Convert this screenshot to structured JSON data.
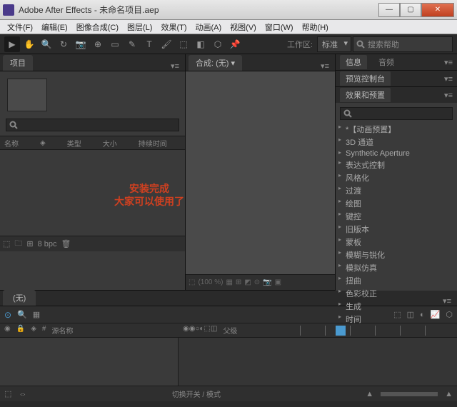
{
  "window": {
    "title": "Adobe After Effects - 未命名项目.aep",
    "minimize": "—",
    "maximize": "▢",
    "close": "✕"
  },
  "menu": {
    "file": "文件(F)",
    "edit": "编辑(E)",
    "compose": "图像合成(C)",
    "layer": "图层(L)",
    "effect": "效果(T)",
    "animation": "动画(A)",
    "view": "视图(V)",
    "window": "窗口(W)",
    "help": "帮助(H)"
  },
  "toolbar": {
    "workspace_label": "工作区:",
    "workspace_value": "标准",
    "search_placeholder": "搜索帮助"
  },
  "project": {
    "tab": "项目",
    "col_name": "名称",
    "col_type": "类型",
    "col_size": "大小",
    "col_duration": "持续时间",
    "bpc": "8 bpc"
  },
  "comp": {
    "tab_prefix": "合成:",
    "tab_value": "(无)",
    "zoom": "(100 %)"
  },
  "panels": {
    "info": "信息",
    "audio": "音频",
    "preview": "预览控制台",
    "effects": "效果和预置"
  },
  "effects": [
    "*【动画预置】",
    "3D 通道",
    "Synthetic Aperture",
    "表达式控制",
    "风格化",
    "过渡",
    "绘图",
    "键控",
    "旧版本",
    "蒙板",
    "模糊与锐化",
    "模拟仿真",
    "扭曲",
    "色彩校正",
    "生成",
    "时间"
  ],
  "timeline": {
    "tab": "(无)",
    "col_source": "源名称",
    "col_parent": "父级",
    "mode_label": "切换开关 / 模式"
  },
  "overlay": {
    "line1": "安装完成",
    "line2": "大家可以使用了"
  }
}
